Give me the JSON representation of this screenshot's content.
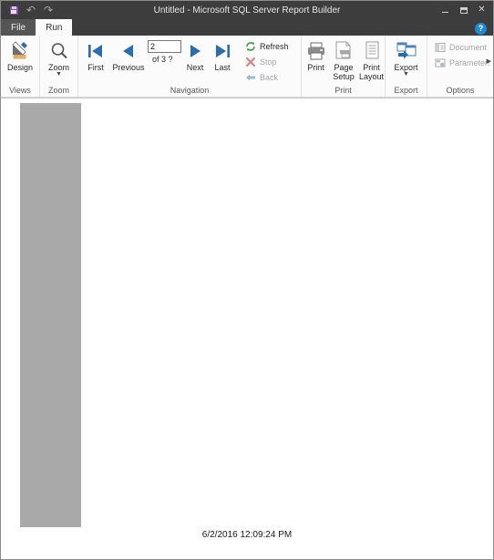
{
  "window": {
    "title": "Untitled - Microsoft SQL Server Report Builder",
    "quick_access": [
      {
        "name": "save",
        "icon": "save-icon",
        "label": "Save"
      },
      {
        "name": "undo",
        "icon": "undo-icon",
        "label": "Undo",
        "glyph": "↶"
      },
      {
        "name": "redo",
        "icon": "redo-icon",
        "label": "Redo",
        "glyph": "↷"
      }
    ],
    "controls": [
      {
        "name": "minimize",
        "label": "Minimize"
      },
      {
        "name": "restore",
        "label": "Restore"
      },
      {
        "name": "close",
        "label": "Close",
        "glyph": "✕"
      }
    ],
    "help_label": "?"
  },
  "tabs": [
    {
      "id": "file",
      "label": "File",
      "active": false
    },
    {
      "id": "run",
      "label": "Run",
      "active": true
    }
  ],
  "ribbon": {
    "groups": [
      {
        "id": "views",
        "label": "Views",
        "items": [
          {
            "id": "design",
            "label": "Design",
            "icon": "design-icon",
            "type": "big",
            "disabled": false
          }
        ]
      },
      {
        "id": "zoom",
        "label": "Zoom",
        "items": [
          {
            "id": "zoom",
            "label": "Zoom",
            "icon": "magnifier-icon",
            "type": "big",
            "dropdown": true,
            "disabled": false
          }
        ]
      },
      {
        "id": "navigation",
        "label": "Navigation",
        "items": [
          {
            "id": "first",
            "label": "First",
            "icon": "first-page-icon",
            "type": "big",
            "disabled": false
          },
          {
            "id": "previous",
            "label": "Previous",
            "icon": "previous-page-icon",
            "type": "big",
            "disabled": false
          },
          {
            "id": "pagebox",
            "type": "pagebox",
            "value": "2",
            "placeholder": "",
            "of_text": "of  3 ?"
          },
          {
            "id": "next",
            "label": "Next",
            "icon": "next-page-icon",
            "type": "big",
            "disabled": false
          },
          {
            "id": "last",
            "label": "Last",
            "icon": "last-page-icon",
            "type": "big",
            "disabled": false
          },
          {
            "id": "refresh",
            "label": "Refresh",
            "icon": "refresh-icon",
            "type": "small",
            "disabled": false
          },
          {
            "id": "stop",
            "label": "Stop",
            "icon": "stop-icon",
            "type": "small",
            "disabled": true
          },
          {
            "id": "back",
            "label": "Back",
            "icon": "back-arrow-icon",
            "type": "small",
            "disabled": true
          }
        ]
      },
      {
        "id": "print",
        "label": "Print",
        "items": [
          {
            "id": "print",
            "label": "Print",
            "icon": "printer-icon",
            "type": "big",
            "disabled": false
          },
          {
            "id": "page-setup",
            "label": "Page\nSetup",
            "label_line1": "Page",
            "label_line2": "Setup",
            "icon": "page-setup-icon",
            "type": "big",
            "disabled": false
          },
          {
            "id": "print-layout",
            "label_line1": "Print",
            "label_line2": "Layout",
            "icon": "print-layout-icon",
            "type": "big",
            "disabled": false
          }
        ]
      },
      {
        "id": "export",
        "label": "Export",
        "items": [
          {
            "id": "export",
            "label": "Export",
            "icon": "export-icon",
            "type": "big",
            "dropdown": true,
            "disabled": false
          }
        ]
      },
      {
        "id": "options",
        "label": "Options",
        "items": [
          {
            "id": "document-map",
            "label": "Document",
            "icon": "document-map-icon",
            "type": "small",
            "disabled": true
          },
          {
            "id": "parameters",
            "label": "Parameters",
            "icon": "parameters-icon",
            "type": "small",
            "disabled": true,
            "has_arrow": true
          }
        ]
      }
    ]
  },
  "document": {
    "footer_timestamp": "6/2/2016 12:09:24 PM",
    "gray_block": {
      "color": "#a9a9a9"
    }
  },
  "colors": {
    "titlebar": "#3d3d3d",
    "ribbon_bg": "#fbfbfb",
    "accent_blue": "#2a6db0",
    "save_purple": "#8a4fa8",
    "help_blue": "#1c8bd4",
    "refresh_green": "#3d9b4e",
    "stop_red": "#d46b6b"
  }
}
